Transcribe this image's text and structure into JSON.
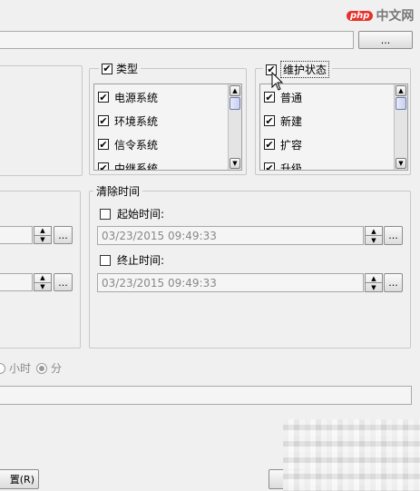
{
  "top_path": {
    "value": "",
    "browse_label": "..."
  },
  "type_group": {
    "title": "类型",
    "checked": true,
    "items": [
      {
        "label": "电源系统",
        "checked": true
      },
      {
        "label": "环境系统",
        "checked": true
      },
      {
        "label": "信令系统",
        "checked": true
      },
      {
        "label": "中继系统",
        "checked": true
      }
    ]
  },
  "maintenance_group": {
    "title": "维护状态",
    "checked": true,
    "items": [
      {
        "label": "普通",
        "checked": true
      },
      {
        "label": "新建",
        "checked": true
      },
      {
        "label": "扩容",
        "checked": true
      },
      {
        "label": "升级",
        "checked": true
      }
    ]
  },
  "clear_time": {
    "title": "清除时间",
    "start": {
      "label": "起始时间:",
      "checked": false,
      "value": "03/23/2015 09:49:33"
    },
    "end": {
      "label": "终止时间:",
      "checked": false,
      "value": "03/23/2015 09:49:33"
    }
  },
  "left_pickers": {
    "browse_label": "..."
  },
  "units": {
    "hour": "小时",
    "minute": "分"
  },
  "bottom": {
    "reset_label": "置(R)"
  },
  "watermark": {
    "text": "中文网",
    "brand": "php"
  },
  "colors": {
    "checkbox_border": "#1c1c1c",
    "group_border": "#c8c8c8",
    "scroll_thumb": "#c8d0f0",
    "watermark_red": "#e8312a"
  }
}
